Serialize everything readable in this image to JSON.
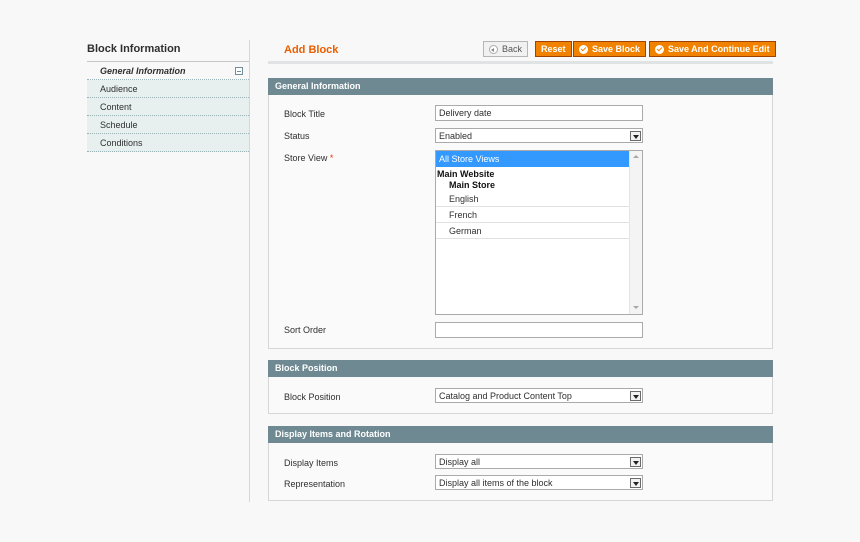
{
  "sidebar": {
    "title": "Block Information",
    "items": [
      {
        "label": "General Information"
      },
      {
        "label": "Audience"
      },
      {
        "label": "Content"
      },
      {
        "label": "Schedule"
      },
      {
        "label": "Conditions"
      }
    ]
  },
  "header": {
    "title": "Add Block",
    "buttons": {
      "back": "Back",
      "reset": "Reset",
      "save": "Save Block",
      "save_continue": "Save And Continue Edit"
    }
  },
  "general": {
    "heading": "General Information",
    "block_title_label": "Block Title",
    "block_title_value": "Delivery date",
    "status_label": "Status",
    "status_value": "Enabled",
    "store_view_label": "Store View",
    "required_mark": "*",
    "store_view_options": {
      "all": "All Store Views",
      "website": "Main Website",
      "store": "Main Store",
      "views": [
        "English",
        "French",
        "German"
      ]
    },
    "sort_order_label": "Sort Order",
    "sort_order_value": ""
  },
  "position": {
    "heading": "Block Position",
    "label": "Block Position",
    "value": "Catalog and Product Content Top"
  },
  "display": {
    "heading": "Display Items and Rotation",
    "items_label": "Display Items",
    "items_value": "Display all",
    "representation_label": "Representation",
    "representation_value": "Display all items of the block"
  }
}
